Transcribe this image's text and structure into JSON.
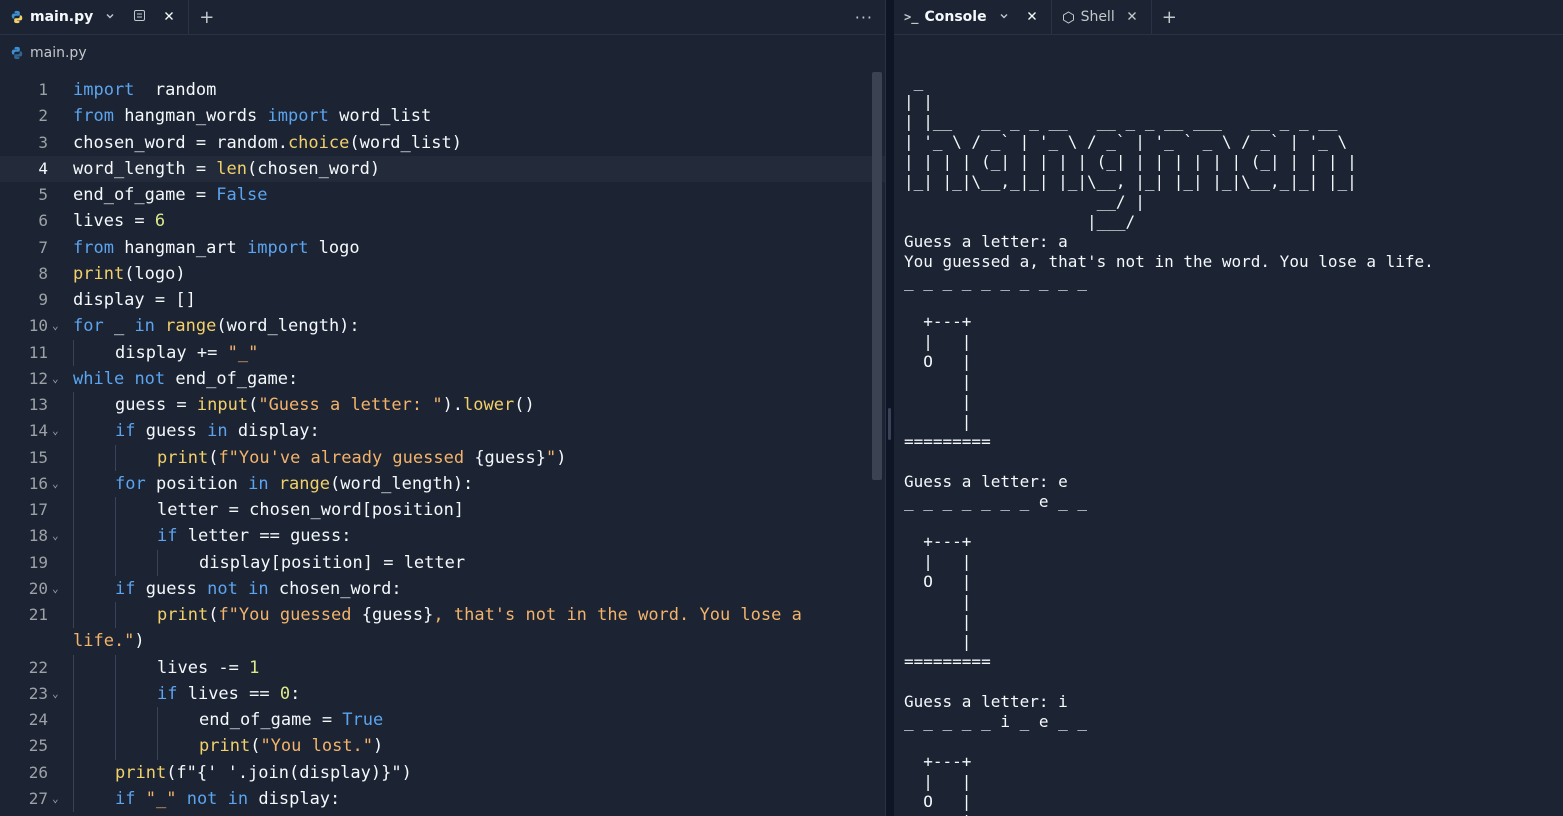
{
  "editor": {
    "tab": {
      "filename": "main.py"
    },
    "breadcrumb": "main.py",
    "lines": [
      {
        "n": "1",
        "fold": false,
        "indent": 0,
        "tokens": [
          [
            "kw",
            "import"
          ],
          [
            "",
            "  random"
          ]
        ]
      },
      {
        "n": "2",
        "fold": false,
        "indent": 0,
        "tokens": [
          [
            "kw",
            "from"
          ],
          [
            "",
            " hangman_words "
          ],
          [
            "kw",
            "import"
          ],
          [
            "",
            " word_list"
          ]
        ]
      },
      {
        "n": "3",
        "fold": false,
        "indent": 0,
        "tokens": [
          [
            "",
            "chosen_word = random."
          ],
          [
            "fn",
            "choice"
          ],
          [
            "",
            "(word_list)"
          ]
        ]
      },
      {
        "n": "4",
        "fold": false,
        "indent": 0,
        "active": true,
        "tokens": [
          [
            "",
            "word_length = "
          ],
          [
            "fn",
            "len"
          ],
          [
            "",
            "(chosen_word)"
          ]
        ]
      },
      {
        "n": "5",
        "fold": false,
        "indent": 0,
        "tokens": [
          [
            "",
            "end_of_game = "
          ],
          [
            "kw",
            "False"
          ]
        ]
      },
      {
        "n": "6",
        "fold": false,
        "indent": 0,
        "tokens": [
          [
            "",
            "lives = "
          ],
          [
            "num",
            "6"
          ]
        ]
      },
      {
        "n": "7",
        "fold": false,
        "indent": 0,
        "tokens": [
          [
            "kw",
            "from"
          ],
          [
            "",
            " hangman_art "
          ],
          [
            "kw",
            "import"
          ],
          [
            "",
            " logo"
          ]
        ]
      },
      {
        "n": "8",
        "fold": false,
        "indent": 0,
        "tokens": [
          [
            "fn",
            "print"
          ],
          [
            "",
            "(logo)"
          ]
        ]
      },
      {
        "n": "9",
        "fold": false,
        "indent": 0,
        "tokens": [
          [
            "",
            "display = []"
          ]
        ]
      },
      {
        "n": "10",
        "fold": true,
        "indent": 0,
        "tokens": [
          [
            "kw",
            "for"
          ],
          [
            "",
            " _ "
          ],
          [
            "kw",
            "in"
          ],
          [
            "",
            " "
          ],
          [
            "fn",
            "range"
          ],
          [
            "",
            "(word_length):"
          ]
        ]
      },
      {
        "n": "11",
        "fold": false,
        "indent": 1,
        "tokens": [
          [
            "",
            "display += "
          ],
          [
            "str",
            "\"_\""
          ]
        ]
      },
      {
        "n": "12",
        "fold": true,
        "indent": 0,
        "tokens": [
          [
            "kw",
            "while"
          ],
          [
            "",
            " "
          ],
          [
            "kw",
            "not"
          ],
          [
            "",
            " end_of_game:"
          ]
        ]
      },
      {
        "n": "13",
        "fold": false,
        "indent": 1,
        "tokens": [
          [
            "",
            "guess = "
          ],
          [
            "fn",
            "input"
          ],
          [
            "",
            "("
          ],
          [
            "str",
            "\"Guess a letter: \""
          ],
          [
            "",
            ")."
          ],
          [
            "fn",
            "lower"
          ],
          [
            "",
            "()"
          ]
        ]
      },
      {
        "n": "14",
        "fold": true,
        "indent": 1,
        "tokens": [
          [
            "kw",
            "if"
          ],
          [
            "",
            " guess "
          ],
          [
            "kw",
            "in"
          ],
          [
            "",
            " display:"
          ]
        ]
      },
      {
        "n": "15",
        "fold": false,
        "indent": 2,
        "tokens": [
          [
            "fn",
            "print"
          ],
          [
            "",
            "("
          ],
          [
            "str",
            "f\"You've already guessed "
          ],
          [
            "",
            "{guess}"
          ],
          [
            "str",
            "\""
          ],
          [
            "",
            ")"
          ]
        ]
      },
      {
        "n": "16",
        "fold": true,
        "indent": 1,
        "tokens": [
          [
            "kw",
            "for"
          ],
          [
            "",
            " position "
          ],
          [
            "kw",
            "in"
          ],
          [
            "",
            " "
          ],
          [
            "fn",
            "range"
          ],
          [
            "",
            "(word_length):"
          ]
        ]
      },
      {
        "n": "17",
        "fold": false,
        "indent": 2,
        "tokens": [
          [
            "",
            "letter = chosen_word[position]"
          ]
        ]
      },
      {
        "n": "18",
        "fold": true,
        "indent": 2,
        "tokens": [
          [
            "kw",
            "if"
          ],
          [
            "",
            " letter == guess:"
          ]
        ]
      },
      {
        "n": "19",
        "fold": false,
        "indent": 3,
        "tokens": [
          [
            "",
            "display[position] = letter"
          ]
        ]
      },
      {
        "n": "20",
        "fold": true,
        "indent": 1,
        "tokens": [
          [
            "kw",
            "if"
          ],
          [
            "",
            " guess "
          ],
          [
            "kw",
            "not"
          ],
          [
            "",
            " "
          ],
          [
            "kw",
            "in"
          ],
          [
            "",
            " chosen_word:"
          ]
        ]
      },
      {
        "n": "21",
        "fold": false,
        "indent": 2,
        "tokens": [
          [
            "fn",
            "print"
          ],
          [
            "",
            "("
          ],
          [
            "str",
            "f\"You guessed "
          ],
          [
            "",
            "{guess}"
          ],
          [
            "str",
            ", that's not in the word. You lose a"
          ]
        ]
      },
      {
        "n": "",
        "fold": false,
        "indent": 0,
        "wrap": true,
        "tokens": [
          [
            "str",
            "life.\""
          ],
          [
            "",
            ")"
          ]
        ]
      },
      {
        "n": "22",
        "fold": false,
        "indent": 2,
        "tokens": [
          [
            "",
            "lives -= "
          ],
          [
            "num",
            "1"
          ]
        ]
      },
      {
        "n": "23",
        "fold": true,
        "indent": 2,
        "tokens": [
          [
            "kw",
            "if"
          ],
          [
            "",
            " lives == "
          ],
          [
            "num",
            "0"
          ],
          [
            "",
            ":"
          ]
        ]
      },
      {
        "n": "24",
        "fold": false,
        "indent": 3,
        "tokens": [
          [
            "",
            "end_of_game = "
          ],
          [
            "kw",
            "True"
          ]
        ]
      },
      {
        "n": "25",
        "fold": false,
        "indent": 3,
        "tokens": [
          [
            "fn",
            "print"
          ],
          [
            "",
            "("
          ],
          [
            "str",
            "\"You lost.\""
          ],
          [
            "",
            ")"
          ]
        ]
      },
      {
        "n": "26",
        "fold": false,
        "indent": 1,
        "tokens": [
          [
            "fn",
            "print"
          ],
          [
            "",
            "(f\"{' '.join(display)}\")"
          ]
        ]
      },
      {
        "n": "27",
        "fold": true,
        "indent": 1,
        "tokens": [
          [
            "kw",
            "if"
          ],
          [
            "",
            " "
          ],
          [
            "str",
            "\"_\""
          ],
          [
            "",
            " "
          ],
          [
            "kw",
            "not"
          ],
          [
            "",
            " "
          ],
          [
            "kw",
            "in"
          ],
          [
            "",
            " display:"
          ]
        ]
      }
    ]
  },
  "console": {
    "tabs": [
      {
        "label": "Console",
        "prefix": ">_"
      },
      {
        "label": "Shell"
      }
    ],
    "output": " _\n| |\n| |__   __ _ _ __   __ _ _ __ ___   __ _ _ __\n| '_ \\ / _` | '_ \\ / _` | '_ ` _ \\ / _` | '_ \\\n| | | | (_| | | | | (_| | | | | | | (_| | | | |\n|_| |_|\\__,_|_| |_|\\__, |_| |_| |_|\\__,_|_| |_|\n                    __/ |\n                   |___/\nGuess a letter: a\nYou guessed a, that's not in the word. You lose a life.\n_ _ _ _ _ _ _ _ _ _\n\n  +---+\n  |   |\n  O   |\n      |\n      |\n      |\n=========\n\nGuess a letter: e\n_ _ _ _ _ _ _ e _ _\n\n  +---+\n  |   |\n  O   |\n      |\n      |\n      |\n=========\n\nGuess a letter: i\n_ _ _ _ _ i _ e _ _\n\n  +---+\n  |   |\n  O   |\n      |"
  },
  "colors": {
    "background": "#1c2333",
    "keyword": "#5ba4ef",
    "function": "#f2d16b",
    "string": "#f2b36b",
    "number": "#dbe98a",
    "python_icon": "#3d8fd1"
  }
}
